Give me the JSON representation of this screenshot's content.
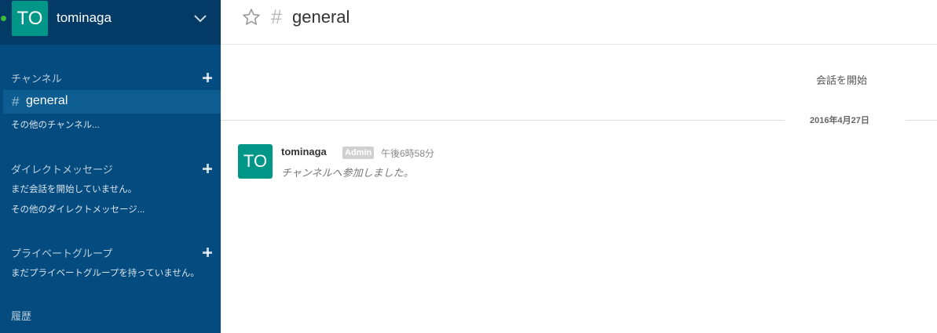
{
  "sidebar": {
    "avatar_initials": "TO",
    "team_name": "tominaga",
    "channels_title": "チャンネル",
    "active_channel_hash": "#",
    "active_channel": "general",
    "more_channels": "その他のチャンネル...",
    "direct_title": "ダイレクトメッセージ",
    "direct_empty": "まだ会話を開始していません。",
    "more_direct": "その他のダイレクトメッセージ...",
    "private_title": "プライベートグループ",
    "private_empty": "まだプライベートグループを持っていません。",
    "history": "履歴"
  },
  "header": {
    "hash": "#",
    "channel_title": "general"
  },
  "main": {
    "start_conversation": "会話を開始",
    "date_divider": "2016年4月27日",
    "message": {
      "avatar_initials": "TO",
      "user": "tominaga",
      "role": "Admin",
      "time": "午後6時58分",
      "text": "チャンネルへ参加しました。"
    }
  },
  "colors": {
    "sidebar_bg": "#044b7f",
    "sidebar_header_bg": "#033a66",
    "active_channel_bg": "#0e5d92",
    "avatar_bg": "#009688",
    "status_online": "#3bbd3b"
  },
  "icons": [
    "chevron-down-icon",
    "plus-icon",
    "star-icon",
    "hash-icon"
  ]
}
